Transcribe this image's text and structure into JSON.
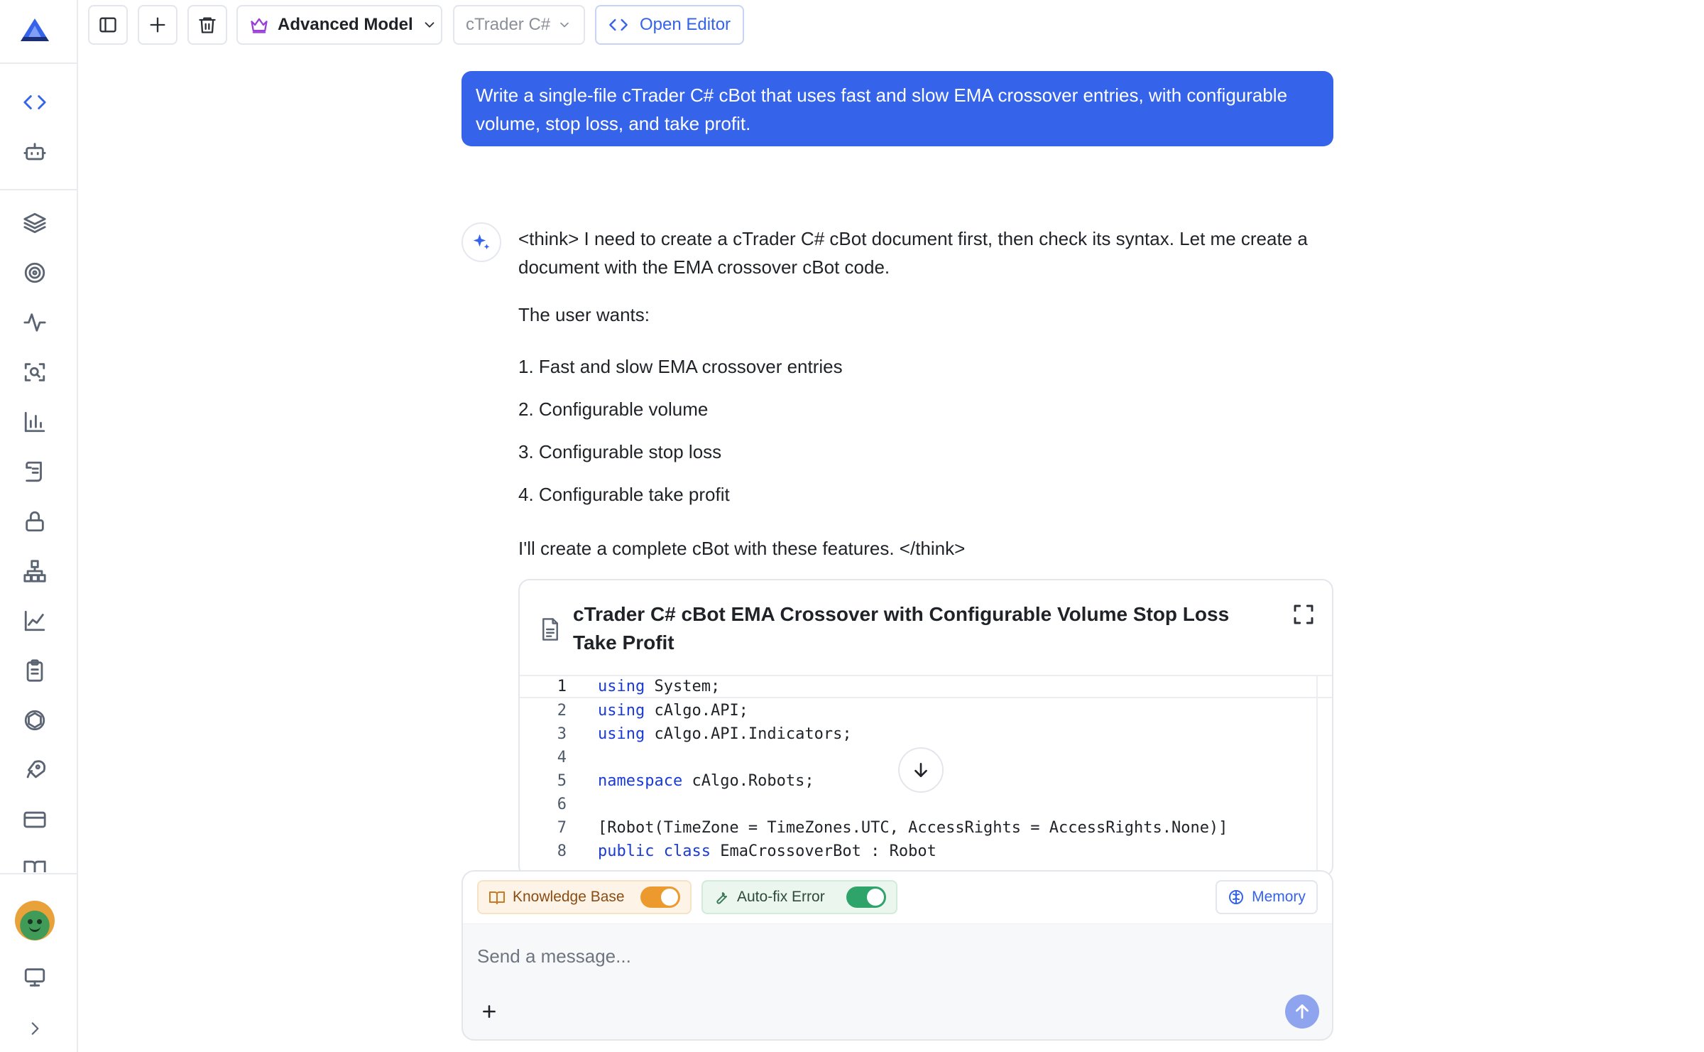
{
  "toolbar": {
    "model_label": "Advanced Model",
    "language_label": "cTrader C#",
    "open_editor_label": "Open Editor"
  },
  "user_message": "Write a single-file cTrader C# cBot that uses fast and slow EMA crossover entries, with configurable volume, stop loss, and take profit.",
  "assistant": {
    "intro": "<think> I need to create a cTrader C# cBot document first, then check its syntax. Let me create a document with the EMA crossover cBot code.",
    "wants_label": "The user wants:",
    "list": [
      "1. Fast and slow EMA crossover entries",
      "2. Configurable volume",
      "3. Configurable stop loss",
      "4. Configurable take profit"
    ],
    "closing": "I'll create a complete cBot with these features. </think>"
  },
  "code_card": {
    "title": "cTrader C# cBot EMA Crossover with Configurable Volume Stop Loss Take Profit",
    "lines": [
      {
        "n": "1",
        "kw": "using",
        "rest": " System;"
      },
      {
        "n": "2",
        "kw": "using",
        "rest": " cAlgo.API;"
      },
      {
        "n": "3",
        "kw": "using",
        "rest": " cAlgo.API.Indicators;"
      },
      {
        "n": "4",
        "kw": "",
        "rest": ""
      },
      {
        "n": "5",
        "kw": "namespace",
        "rest": " cAlgo.Robots;"
      },
      {
        "n": "6",
        "kw": "",
        "rest": ""
      },
      {
        "n": "7",
        "kw": "",
        "rest": "[Robot(TimeZone = TimeZones.UTC, AccessRights = AccessRights.None)]"
      },
      {
        "n": "8",
        "kw": "public class",
        "rest": " EmaCrossoverBot : Robot"
      }
    ]
  },
  "composer": {
    "knowledge_base_label": "Knowledge Base",
    "knowledge_base_on": true,
    "autofix_label": "Auto-fix Error",
    "autofix_on": true,
    "memory_label": "Memory",
    "placeholder": "Send a message..."
  },
  "colors": {
    "accent": "#3563e9",
    "knowledge_base": "#ec9a2e",
    "autofix": "#2ea36a"
  }
}
